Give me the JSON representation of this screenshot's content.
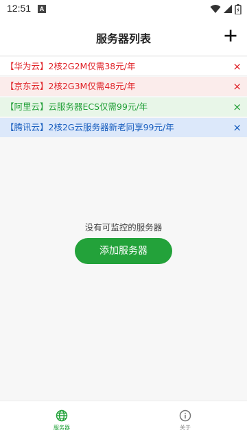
{
  "status_bar": {
    "time": "12:51",
    "notification_badge": "A"
  },
  "header": {
    "title": "服务器列表",
    "add_icon": "plus-icon"
  },
  "promos": [
    {
      "text": "【华为云】2核2G2M仅需38元/年",
      "color": "#e0242a",
      "background": "#ffffff"
    },
    {
      "text": "【京东云】2核2G3M仅需48元/年",
      "color": "#e0242a",
      "background": "#fbeceb"
    },
    {
      "text": "【阿里云】云服务器ECS仅需99元/年",
      "color": "#1f9e35",
      "background": "#e8f6e8"
    },
    {
      "text": "【腾讯云】2核2G云服务器新老同享99元/年",
      "color": "#1a5fbf",
      "background": "#dce8fa"
    }
  ],
  "close_symbol": "×",
  "empty_state": {
    "message": "没有可监控的服务器",
    "button_label": "添加服务器",
    "button_color": "#23a23a"
  },
  "bottom_nav": {
    "items": [
      {
        "label": "服务器",
        "icon": "globe-icon",
        "active": true
      },
      {
        "label": "关于",
        "icon": "info-icon",
        "active": false
      }
    ],
    "active_color": "#23a23a",
    "inactive_color": "#8a8a8a"
  }
}
